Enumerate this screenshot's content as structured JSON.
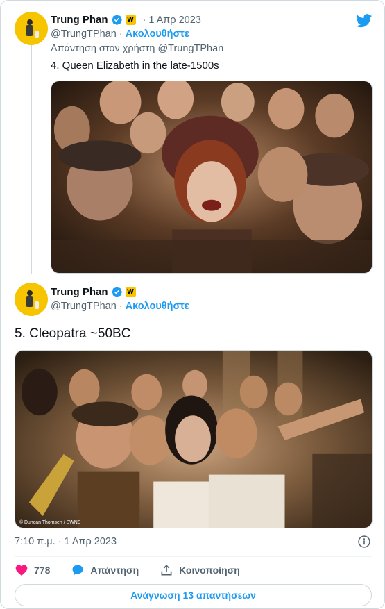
{
  "colors": {
    "accent": "#1d9bf0",
    "like": "#f91880",
    "text": "#0f1419",
    "muted": "#536471",
    "border": "#cfd9de"
  },
  "logo": {
    "icon": "twitter-bird-icon"
  },
  "reply_tweet": {
    "display_name": "Trung Phan",
    "verified_icon": "verified-badge-icon",
    "affiliate_badge": "W",
    "separator": "·",
    "date": "1 Απρ 2023",
    "handle": "@TrungTPhan",
    "handle_separator": "·",
    "follow_label": "Ακολουθήστε",
    "replying_to": "Απάντηση στον χρήστη @TrungTPhan",
    "text": "4. Queen Elizabeth in the late-1500s",
    "image_icon": "photo-queen-elizabeth-selfie"
  },
  "main_tweet": {
    "display_name": "Trung Phan",
    "verified_icon": "verified-badge-icon",
    "affiliate_badge": "W",
    "handle": "@TrungTPhan",
    "handle_separator": "·",
    "follow_label": "Ακολουθήστε",
    "text": "5. Cleopatra ~50BC",
    "image_credit": "© Duncan Thomsen / SWNS",
    "image_icon": "photo-cleopatra-selfie",
    "timestamp": "7:10 π.μ. · 1 Απρ 2023",
    "info_icon": "info-icon"
  },
  "actions": {
    "like_count": "778",
    "like_icon": "heart-icon",
    "reply_label": "Απάντηση",
    "reply_icon": "speech-bubble-icon",
    "share_label": "Κοινοποίηση",
    "share_icon": "share-upload-icon"
  },
  "read_replies_label": "Ανάγνωση 13 απαντήσεων"
}
